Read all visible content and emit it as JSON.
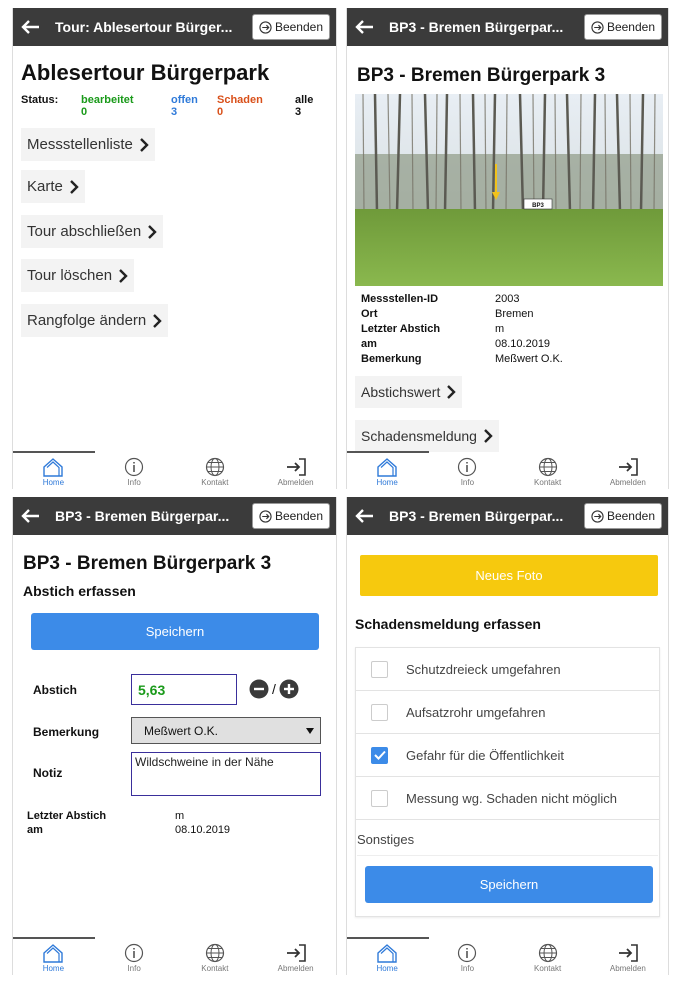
{
  "nav": {
    "home": "Home",
    "info": "Info",
    "contact": "Kontakt",
    "logout": "Abmelden",
    "end_label": "Beenden"
  },
  "screen1": {
    "topbar_title": "Tour: Ablesertour Bürger...",
    "heading": "Ablesertour Bürgerpark",
    "status_label": "Status:",
    "status": [
      {
        "label": "bearbeitet",
        "count": "0",
        "color": "#1a9a1a"
      },
      {
        "label": "offen",
        "count": "3",
        "color": "#2f7ad9"
      },
      {
        "label": "Schaden",
        "count": "0",
        "color": "#d9501a"
      },
      {
        "label": "alle",
        "count": "3",
        "color": "#111111"
      }
    ],
    "buttons": [
      "Messstellenliste",
      "Karte",
      "Tour abschließen",
      "Tour löschen",
      "Rangfolge ändern"
    ]
  },
  "screen2": {
    "topbar_title": "BP3 - Bremen Bürgerpar...",
    "heading": "BP3 - Bremen Bürgerpark 3",
    "photo_sign": "BP3",
    "details": [
      {
        "label": "Messstellen-ID",
        "value": "2003"
      },
      {
        "label": "Ort",
        "value": "Bremen"
      },
      {
        "label": "Letzter Abstich",
        "value": "m"
      },
      {
        "label": "am",
        "value": "08.10.2019"
      },
      {
        "label": "Bemerkung",
        "value": "Meßwert O.K."
      }
    ],
    "buttons": [
      "Abstichswert",
      "Schadensmeldung"
    ]
  },
  "screen3": {
    "topbar_title": "BP3 - Bremen Bürgerpar...",
    "heading": "BP3 - Bremen Bürgerpark 3",
    "subheading": "Abstich erfassen",
    "save": "Speichern",
    "abstich_label": "Abstich",
    "abstich_value": "5,63",
    "stepper_sep": "/",
    "remark_label": "Bemerkung",
    "remark_value": "Meßwert O.K.",
    "note_label": "Notiz",
    "note_value": "Wildschweine in der Nähe",
    "last_label": "Letzter Abstich",
    "last_value": "m",
    "date_label": "am",
    "date_value": "08.10.2019"
  },
  "screen4": {
    "topbar_title": "BP3 - Bremen Bürgerpar...",
    "photo_button": "Neues Foto",
    "photo_button_color": "#f6c90e",
    "heading": "Schadensmeldung erfassen",
    "options": [
      {
        "label": "Schutzdreieck umgefahren",
        "checked": false
      },
      {
        "label": "Aufsatzrohr umgefahren",
        "checked": false
      },
      {
        "label": "Gefahr für die Öffentlichkeit",
        "checked": true
      },
      {
        "label": "Messung wg. Schaden nicht möglich",
        "checked": false
      }
    ],
    "other_placeholder": "Sonstiges",
    "save": "Speichern"
  }
}
